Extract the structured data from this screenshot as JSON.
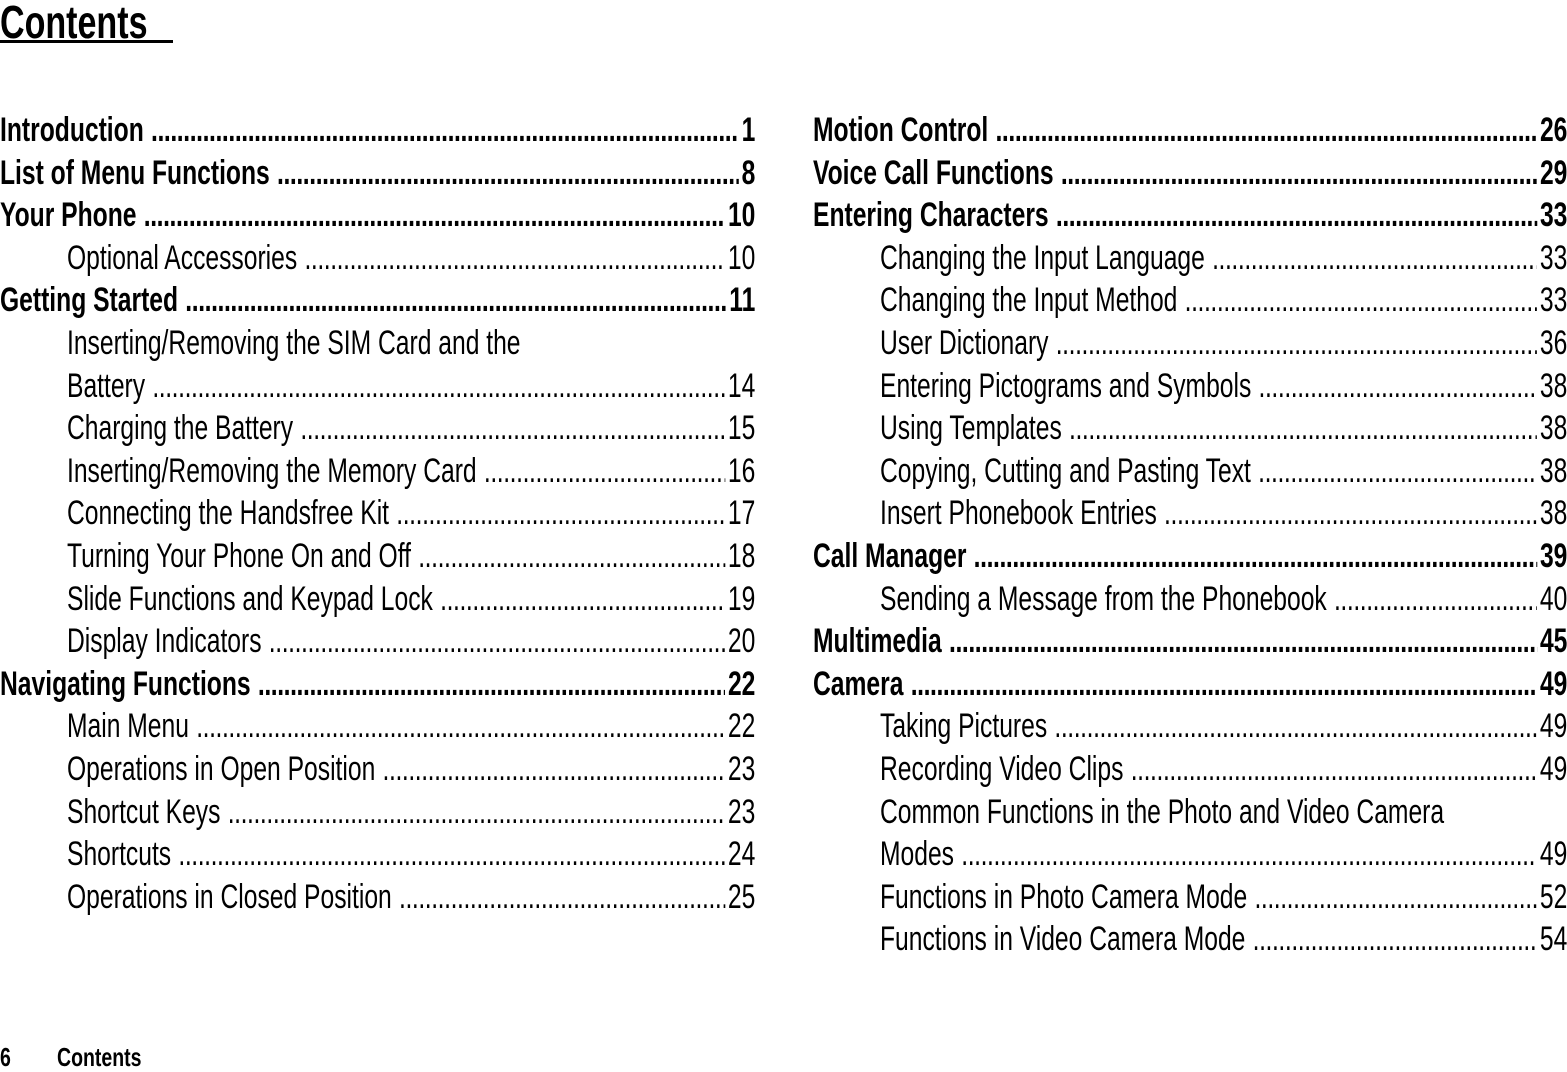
{
  "page": {
    "title": "Contents",
    "footer": {
      "page_number": "6",
      "section": "Contents"
    }
  },
  "toc": {
    "left": [
      {
        "level": 1,
        "label": "Introduction",
        "page": "1"
      },
      {
        "level": 1,
        "label": "List of Menu Functions",
        "page": "8"
      },
      {
        "level": 1,
        "label": "Your Phone",
        "page": "10"
      },
      {
        "level": 2,
        "label": "Optional Accessories",
        "page": "10"
      },
      {
        "level": 1,
        "label": "Getting Started",
        "page": "11"
      },
      {
        "level": 2,
        "label": "Inserting/Removing the SIM Card and the",
        "page": "",
        "continued": true
      },
      {
        "level": 2,
        "label": "Battery",
        "page": "14"
      },
      {
        "level": 2,
        "label": "Charging the Battery",
        "page": "15"
      },
      {
        "level": 2,
        "label": "Inserting/Removing the Memory Card",
        "page": "16"
      },
      {
        "level": 2,
        "label": "Connecting the Handsfree Kit",
        "page": "17"
      },
      {
        "level": 2,
        "label": "Turning Your Phone On and Off",
        "page": "18"
      },
      {
        "level": 2,
        "label": "Slide Functions and Keypad Lock",
        "page": "19"
      },
      {
        "level": 2,
        "label": "Display Indicators",
        "page": "20"
      },
      {
        "level": 1,
        "label": "Navigating Functions",
        "page": "22"
      },
      {
        "level": 2,
        "label": "Main Menu",
        "page": "22"
      },
      {
        "level": 2,
        "label": "Operations in Open Position",
        "page": "23"
      },
      {
        "level": 2,
        "label": "Shortcut Keys",
        "page": "23"
      },
      {
        "level": 2,
        "label": "Shortcuts",
        "page": "24"
      },
      {
        "level": 2,
        "label": "Operations in Closed Position",
        "page": "25"
      }
    ],
    "right": [
      {
        "level": 1,
        "label": "Motion Control",
        "page": "26"
      },
      {
        "level": 1,
        "label": "Voice Call Functions",
        "page": "29"
      },
      {
        "level": 1,
        "label": "Entering Characters",
        "page": "33"
      },
      {
        "level": 2,
        "label": "Changing the Input Language",
        "page": "33"
      },
      {
        "level": 2,
        "label": "Changing the Input Method",
        "page": "33"
      },
      {
        "level": 2,
        "label": "User Dictionary",
        "page": "36"
      },
      {
        "level": 2,
        "label": "Entering Pictograms and Symbols",
        "page": "38"
      },
      {
        "level": 2,
        "label": "Using Templates",
        "page": "38"
      },
      {
        "level": 2,
        "label": "Copying, Cutting and Pasting Text",
        "page": "38"
      },
      {
        "level": 2,
        "label": "Insert Phonebook Entries",
        "page": "38"
      },
      {
        "level": 1,
        "label": "Call Manager",
        "page": "39"
      },
      {
        "level": 2,
        "label": "Sending a Message from the Phonebook",
        "page": "40"
      },
      {
        "level": 1,
        "label": "Multimedia",
        "page": "45"
      },
      {
        "level": 1,
        "label": "Camera",
        "page": "49"
      },
      {
        "level": 2,
        "label": "Taking Pictures",
        "page": "49"
      },
      {
        "level": 2,
        "label": "Recording Video Clips",
        "page": "49"
      },
      {
        "level": 2,
        "label": "Common Functions in the Photo and Video Camera",
        "page": "",
        "continued": true
      },
      {
        "level": 2,
        "label": "Modes",
        "page": "49"
      },
      {
        "level": 2,
        "label": "Functions in Photo Camera Mode",
        "page": "52"
      },
      {
        "level": 2,
        "label": "Functions in Video Camera Mode",
        "page": "54"
      }
    ]
  }
}
